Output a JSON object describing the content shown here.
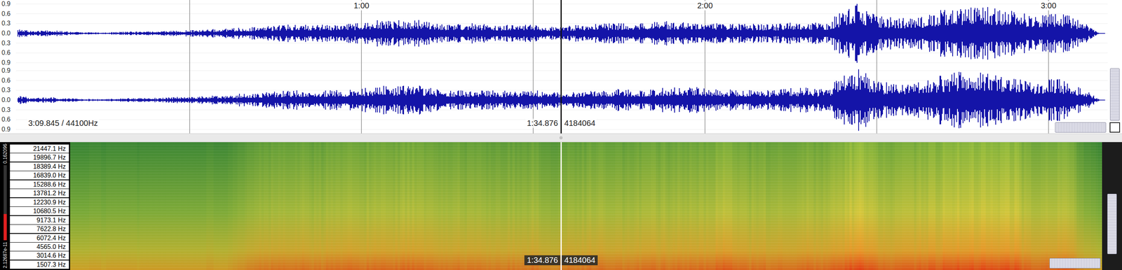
{
  "waveform": {
    "duration_label": "3:09.845 / 44100Hz",
    "time_ticks": [
      "1:00",
      "2:00",
      "3:00"
    ],
    "channels": [
      {
        "scale": [
          "0.9",
          "0.6",
          "0.3",
          "0.0",
          "0.3",
          "0.6",
          "0.9"
        ],
        "envelope": [
          0.12,
          0.08,
          0.1,
          0.05,
          0.04,
          0.03,
          0.05,
          0.06,
          0.07,
          0.08,
          0.1,
          0.12,
          0.14,
          0.18,
          0.2,
          0.25,
          0.28,
          0.3,
          0.28,
          0.3,
          0.35,
          0.42,
          0.4,
          0.45,
          0.38,
          0.3,
          0.32,
          0.3,
          0.28,
          0.25,
          0.3,
          0.22,
          0.25,
          0.28,
          0.3,
          0.32,
          0.3,
          0.35,
          0.38,
          0.42,
          0.35,
          0.3,
          0.32,
          0.3,
          0.28,
          0.35,
          0.38,
          0.3,
          0.7,
          0.95,
          0.55,
          0.5,
          0.45,
          0.6,
          0.8,
          0.85,
          0.9,
          0.75,
          0.7,
          0.55,
          0.65,
          0.6,
          0.35,
          0.0
        ]
      },
      {
        "scale": [
          "0.9",
          "0.6",
          "0.3",
          "0.0",
          "0.3",
          "0.6",
          "0.9"
        ],
        "envelope": [
          0.13,
          0.07,
          0.09,
          0.05,
          0.04,
          0.03,
          0.05,
          0.06,
          0.07,
          0.09,
          0.11,
          0.13,
          0.15,
          0.2,
          0.22,
          0.27,
          0.3,
          0.33,
          0.3,
          0.32,
          0.38,
          0.45,
          0.42,
          0.47,
          0.4,
          0.3,
          0.33,
          0.31,
          0.3,
          0.27,
          0.32,
          0.24,
          0.27,
          0.3,
          0.33,
          0.35,
          0.32,
          0.37,
          0.4,
          0.44,
          0.37,
          0.32,
          0.33,
          0.31,
          0.3,
          0.37,
          0.4,
          0.32,
          0.75,
          0.98,
          0.6,
          0.55,
          0.5,
          0.65,
          0.82,
          0.88,
          0.92,
          0.78,
          0.72,
          0.58,
          0.68,
          0.62,
          0.38,
          0.0
        ]
      }
    ]
  },
  "cursor": {
    "time": "1:34.876",
    "sample": "4184064"
  },
  "spectrogram": {
    "frequency_labels": [
      "21447.1 Hz",
      "19896.7 Hz",
      "18389.4 Hz",
      "16839.0 Hz",
      "15288.6 Hz",
      "13781.2 Hz",
      "12230.9 Hz",
      "10680.5 Hz",
      "9173.1 Hz",
      "7622.8 Hz",
      "6072.4 Hz",
      "4565.0 Hz",
      "3014.6 Hz",
      "1507.3 Hz"
    ],
    "intensity": [
      0.15,
      0.12,
      0.14,
      0.1,
      0.12,
      0.13,
      0.15,
      0.14,
      0.16,
      0.15,
      0.16,
      0.17,
      0.18,
      0.3,
      0.5,
      0.52,
      0.55,
      0.5,
      0.55,
      0.6,
      0.58,
      0.62,
      0.6,
      0.65,
      0.58,
      0.55,
      0.5,
      0.52,
      0.48,
      0.5,
      0.55,
      0.35,
      0.5,
      0.52,
      0.55,
      0.5,
      0.55,
      0.6,
      0.58,
      0.62,
      0.6,
      0.75,
      0.6,
      0.58,
      0.55,
      0.6,
      0.62,
      0.6,
      0.8,
      0.95,
      0.7,
      0.68,
      0.72,
      0.75,
      0.8,
      0.85,
      0.9,
      0.85,
      0.88,
      0.6,
      0.7,
      0.72,
      0.3,
      0.1
    ],
    "meter": {
      "max_label": "0.162096",
      "min_label": "2.12687e-11",
      "level": 0.35
    }
  }
}
